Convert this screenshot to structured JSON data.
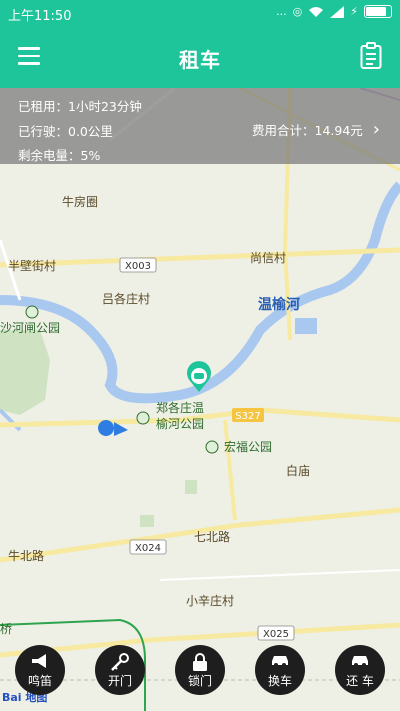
{
  "status_bar": {
    "time": "上午11:50",
    "dots": "...",
    "battery_level": 0.9
  },
  "app_bar": {
    "title": "租车"
  },
  "rental_info": {
    "rented_label": "已租用：1小时23分钟",
    "distance_label": "已行驶：0.0公里",
    "battery_label": "剩余电量：5%",
    "cost_label": "费用合计：14.94元"
  },
  "map": {
    "labels": {
      "niufangquan": "牛房圈",
      "banbijie": "半壁街村",
      "x003": "X003",
      "shangxin": "尚信村",
      "lvgezhuang": "吕各庄村",
      "wenyuhe": "温榆河",
      "shahe_park": "沙河闸公园",
      "zhengge1": "郑各庄温",
      "zhengge2": "榆河公园",
      "s327": "S327",
      "hongfu": "宏福公园",
      "baimiao": "白庙",
      "qibeilu": "七北路",
      "niubeilu": "牛北路",
      "x024": "X024",
      "xiaoxin": "小辛庄村",
      "x025": "X025",
      "huaqiao": "桥",
      "baidu": "Bai 地图"
    }
  },
  "actions": [
    {
      "label": "鸣笛",
      "icon": "horn-icon"
    },
    {
      "label": "开门",
      "icon": "key-icon"
    },
    {
      "label": "锁门",
      "icon": "lock-icon"
    },
    {
      "label": "换车",
      "icon": "car-icon"
    },
    {
      "label": "还 车",
      "icon": "car-return-icon"
    }
  ],
  "colors": {
    "accent": "#1ec59a",
    "water": "#a9c8f0",
    "road": "#f7e9a0"
  }
}
